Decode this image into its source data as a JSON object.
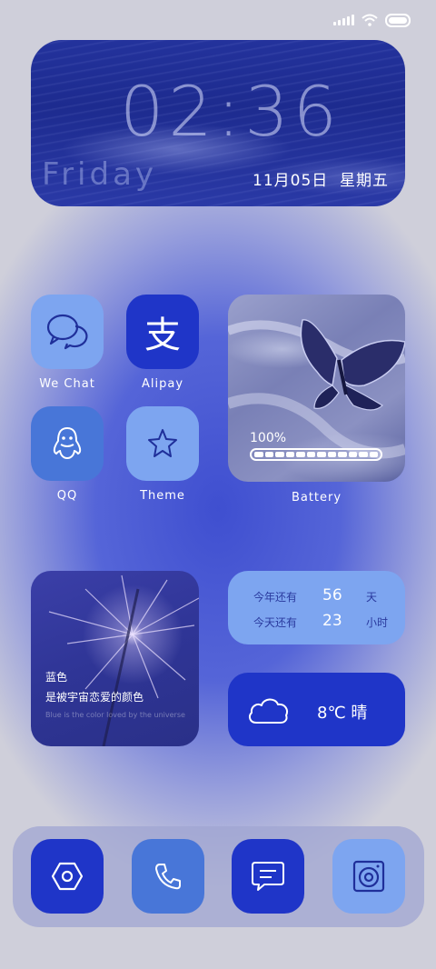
{
  "clock": {
    "time": "02:36",
    "day": "Friday",
    "date": "11月05日",
    "weekday": "星期五"
  },
  "apps": [
    {
      "label": "We Chat",
      "icon": "chat-bubbles-icon"
    },
    {
      "label": "Alipay",
      "icon": "alipay-icon",
      "glyph": "支"
    },
    {
      "label": "QQ",
      "icon": "penguin-icon"
    },
    {
      "label": "Theme",
      "icon": "star-icon"
    }
  ],
  "battery_widget": {
    "percent_text": "100%",
    "level": 1.0,
    "label": "Battery"
  },
  "quote": {
    "title": "蓝色",
    "text": "是被宇宙恋爱的颜色",
    "english": "Blue is the color  loved by the universe"
  },
  "countdown": {
    "rows": [
      {
        "prefix": "今年还有",
        "value": "56",
        "unit": "天"
      },
      {
        "prefix": "今天还有",
        "value": "23",
        "unit": "小时"
      }
    ]
  },
  "weather": {
    "text": "8℃ 晴",
    "icon": "cloud-icon"
  },
  "dock": [
    {
      "icon": "settings-hexagon-icon"
    },
    {
      "icon": "phone-icon"
    },
    {
      "icon": "message-icon"
    },
    {
      "icon": "camera-icon"
    }
  ],
  "colors": {
    "tile_dark": "#1f35c8",
    "tile_mid": "#4876d8",
    "tile_light": "#7da5f0",
    "icon_dark": "#1f2f9a"
  }
}
